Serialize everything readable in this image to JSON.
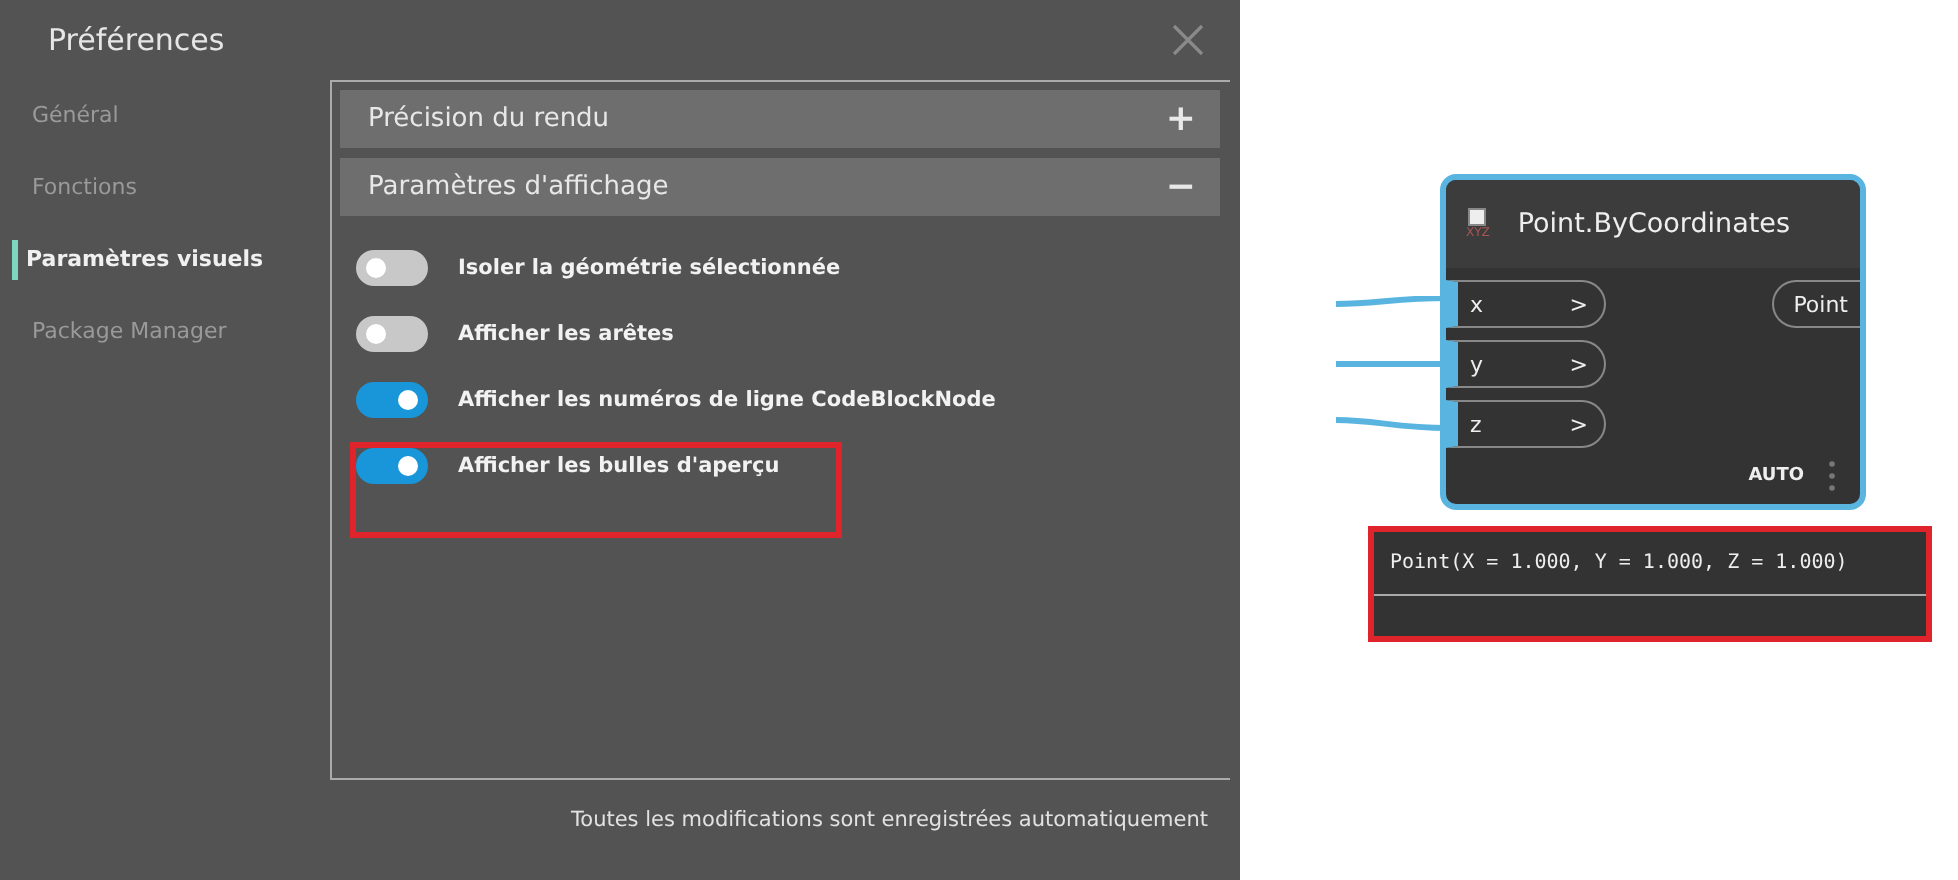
{
  "window": {
    "title": "Préférences"
  },
  "sidebar": {
    "items": [
      {
        "label": "Général",
        "selected": false
      },
      {
        "label": "Fonctions",
        "selected": false
      },
      {
        "label": "Paramètres visuels",
        "selected": true
      },
      {
        "label": "Package Manager",
        "selected": false
      }
    ]
  },
  "sections": [
    {
      "title": "Précision du rendu",
      "toggle_symbol": "+"
    },
    {
      "title": "Paramètres d'affichage",
      "toggle_symbol": "−"
    }
  ],
  "settings": [
    {
      "label": "Isoler la géométrie sélectionnée",
      "on": false,
      "highlighted": false
    },
    {
      "label": "Afficher les arêtes",
      "on": false,
      "highlighted": false
    },
    {
      "label": "Afficher les numéros de ligne CodeBlockNode",
      "on": true,
      "highlighted": false
    },
    {
      "label": "Afficher les bulles d'aperçu",
      "on": true,
      "highlighted": true
    }
  ],
  "footer": "Toutes les modifications sont enregistrées automatiquement",
  "node": {
    "icon_label": "XYZ",
    "title": "Point.ByCoordinates",
    "inputs": [
      {
        "name": "x",
        "arrow": ">"
      },
      {
        "name": "y",
        "arrow": ">"
      },
      {
        "name": "z",
        "arrow": ">"
      }
    ],
    "output": "Point",
    "lacing": "AUTO"
  },
  "preview": {
    "text": "Point(X = 1.000, Y = 1.000, Z = 1.000)",
    "highlighted": true
  }
}
